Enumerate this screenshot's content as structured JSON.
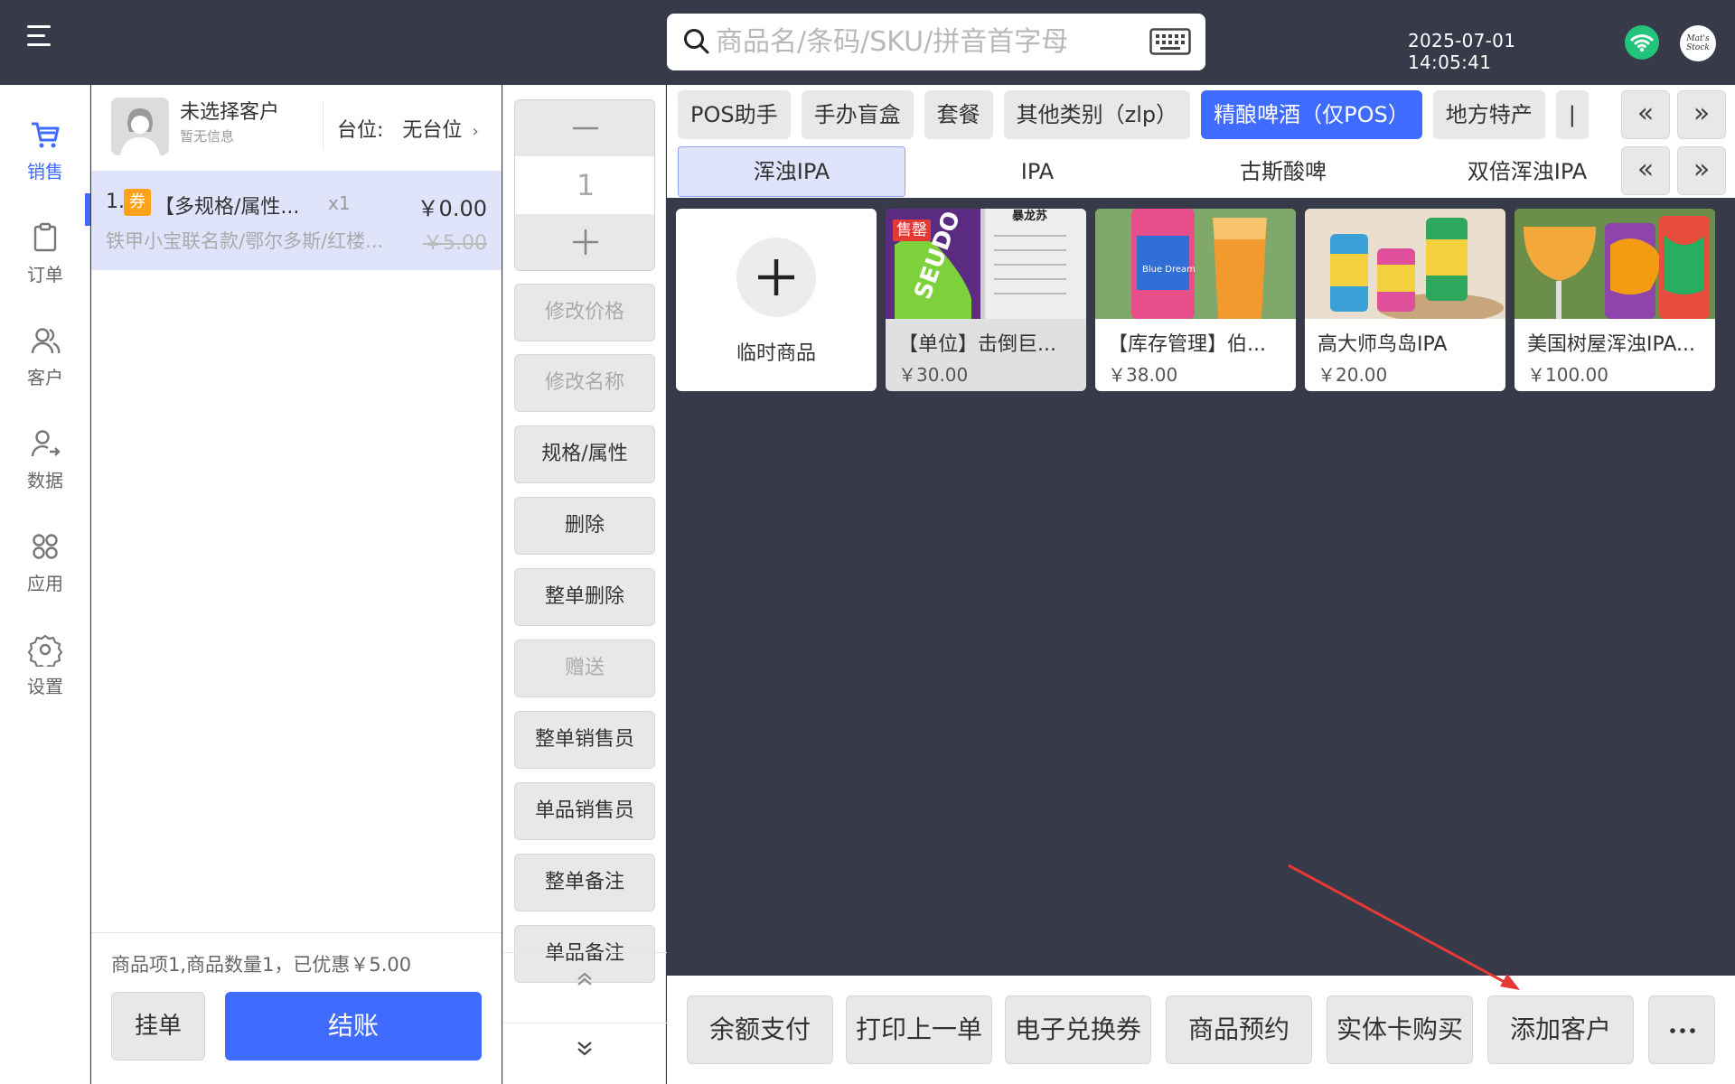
{
  "header": {
    "search_placeholder": "商品名/条码/SKU/拼音首字母",
    "datetime": "2025-07-01 14:05:41",
    "logo_text": "Mat's Stock"
  },
  "sidebar": {
    "items": [
      {
        "label": "销售",
        "icon": "cart-icon",
        "active": true
      },
      {
        "label": "订单",
        "icon": "clipboard-icon"
      },
      {
        "label": "客户",
        "icon": "users-icon"
      },
      {
        "label": "数据",
        "icon": "user-stats-icon"
      },
      {
        "label": "应用",
        "icon": "apps-grid-icon"
      },
      {
        "label": "设置",
        "icon": "gear-icon"
      }
    ]
  },
  "cart": {
    "customer_name": "未选择客户",
    "customer_sub": "暂无信息",
    "table_label": "台位:",
    "table_value": "无台位",
    "item": {
      "index": "1.",
      "badge": "券",
      "name": "【多规格/属性...",
      "qty": "x1",
      "price": "￥0.00",
      "spec": "铁甲小宝联名款/鄂尔多斯/红楼...",
      "original_price": "￥5.00"
    },
    "summary": "商品项1,商品数量1，已优惠￥5.00",
    "hold_label": "挂单",
    "checkout_label": "结账"
  },
  "actions": {
    "quantity": "1",
    "buttons": [
      {
        "label": "修改价格",
        "enabled": false
      },
      {
        "label": "修改名称",
        "enabled": false
      },
      {
        "label": "规格/属性",
        "enabled": true
      },
      {
        "label": "删除",
        "enabled": true
      },
      {
        "label": "整单删除",
        "enabled": true
      },
      {
        "label": "赠送",
        "enabled": false
      },
      {
        "label": "整单销售员",
        "enabled": true
      },
      {
        "label": "单品销售员",
        "enabled": true
      },
      {
        "label": "整单备注",
        "enabled": true
      },
      {
        "label": "单品备注",
        "enabled": true
      }
    ]
  },
  "categories": {
    "tabs": [
      "POS助手",
      "手办盲盒",
      "套餐",
      "其他类别（zlp）",
      "精酿啤酒（仅POS）",
      "地方特产",
      "|"
    ],
    "active_tab": "精酿啤酒（仅POS）",
    "subtabs": [
      "浑浊IPA",
      "IPA",
      "古斯酸啤",
      "双倍浑浊IPA"
    ],
    "active_subtab": "浑浊IPA",
    "prev_label": "«",
    "next_label": "»"
  },
  "products": {
    "temp_label": "临时商品",
    "items": [
      {
        "name": "【单位】击倒巨...",
        "price": "￥30.00",
        "badge": "售罄",
        "img_text": "暴龙苏"
      },
      {
        "name": "【库存管理】伯...",
        "price": "￥38.00",
        "img_text": "Blue Dream"
      },
      {
        "name": "高大师鸟岛IPA",
        "price": "￥20.00"
      },
      {
        "name": "美国树屋浑浊IPA...",
        "price": "￥100.00"
      }
    ]
  },
  "bottom": {
    "buttons": [
      "余额支付",
      "打印上一单",
      "电子兑换券",
      "商品预约",
      "实体卡购买",
      "添加客户"
    ],
    "more_label": "..."
  },
  "colors": {
    "primary": "#3f6bff",
    "background": "#363a49",
    "wifi": "#21c47a",
    "badge": "#ffa31a",
    "sold_out": "#e53935",
    "annotation_arrow": "#e53935"
  }
}
